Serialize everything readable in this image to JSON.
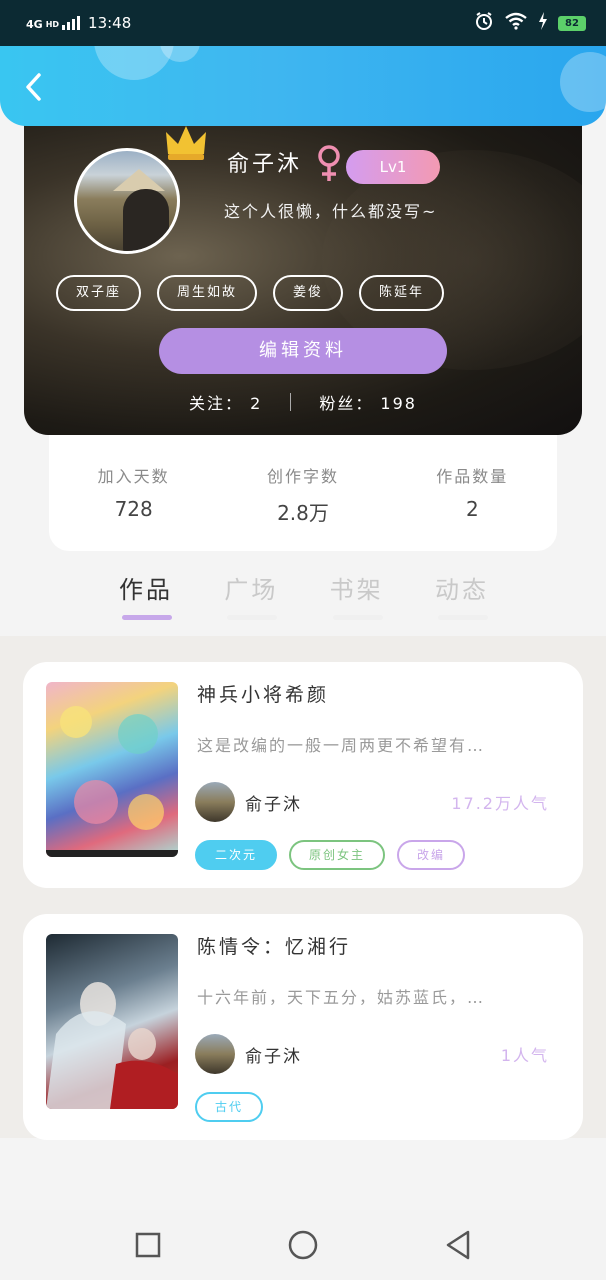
{
  "status_bar": {
    "network": "4G",
    "network_sup": "HD",
    "time": "13:48",
    "battery": "82"
  },
  "header": {
    "back_icon": "chevron-left-icon"
  },
  "profile": {
    "name": "俞子沐",
    "gender_icon": "female-icon",
    "level": "Lv1",
    "bio": "这个人很懒，什么都没写~",
    "tags": [
      "双子座",
      "周生如故",
      "姜俊",
      "陈延年"
    ],
    "edit_label": "编辑资料",
    "following_label": "关注：",
    "following_count": "2",
    "fans_label": "粉丝：",
    "fans_count": "198"
  },
  "stats": [
    {
      "label": "加入天数",
      "value": "728"
    },
    {
      "label": "创作字数",
      "value": "2.8万"
    },
    {
      "label": "作品数量",
      "value": "2"
    }
  ],
  "tabs": [
    {
      "label": "作品",
      "active": true
    },
    {
      "label": "广场",
      "active": false
    },
    {
      "label": "书架",
      "active": false
    },
    {
      "label": "动态",
      "active": false
    }
  ],
  "works": [
    {
      "title": "神兵小将希颜",
      "desc": "这是改编的一般一周两更不希望有…",
      "author": "俞子沐",
      "popularity": "17.2万人气",
      "tags": [
        {
          "label": "二次元",
          "color": "#4fcdf0",
          "filled": true
        },
        {
          "label": "原创女主",
          "color": "#7cc47f",
          "filled": false
        },
        {
          "label": "改编",
          "color": "#c9a6ea",
          "filled": false
        }
      ]
    },
    {
      "title": "陈情令：忆湘行",
      "desc": "十六年前，天下五分，姑苏蓝氏，…",
      "author": "俞子沐",
      "popularity": "1人气",
      "tags": [
        {
          "label": "古代",
          "color": "#4fcdf0",
          "filled": false
        }
      ]
    }
  ],
  "nav": {
    "recent_icon": "square-icon",
    "home_icon": "circle-icon",
    "back_icon": "triangle-back-icon"
  },
  "colors": {
    "header_blue": "#3fb6f0",
    "accent_purple": "#b58fe3",
    "level_gradient_start": "#d49cf0",
    "level_gradient_end": "#f39ab2"
  }
}
